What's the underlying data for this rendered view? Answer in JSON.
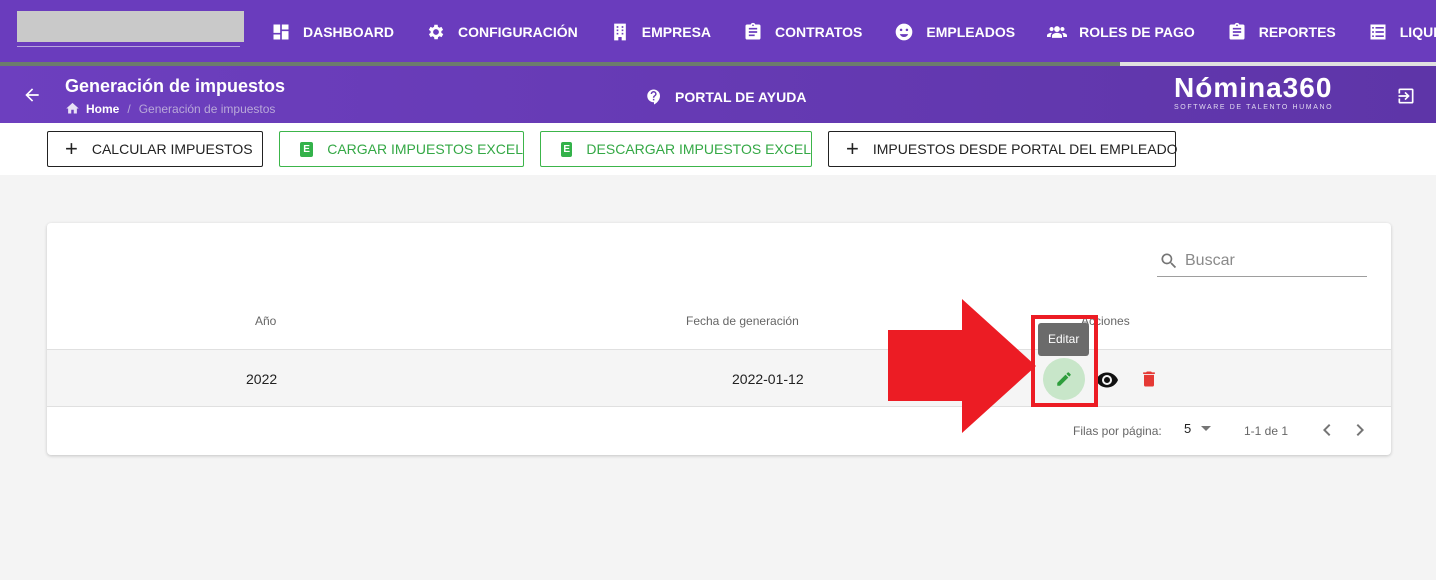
{
  "nav": {
    "items": [
      {
        "label": "DASHBOARD",
        "icon": "dashboard-icon"
      },
      {
        "label": "CONFIGURACIÓN",
        "icon": "gear-icon"
      },
      {
        "label": "EMPRESA",
        "icon": "building-icon"
      },
      {
        "label": "CONTRATOS",
        "icon": "clipboard-icon"
      },
      {
        "label": "EMPLEADOS",
        "icon": "face-icon"
      },
      {
        "label": "ROLES DE PAGO",
        "icon": "group-icon"
      },
      {
        "label": "REPORTES",
        "icon": "clipboard-icon"
      },
      {
        "label": "LIQUIDACIONE",
        "icon": "list-icon"
      }
    ],
    "progress": 0.78
  },
  "header": {
    "title": "Generación de impuestos",
    "breadcrumb": {
      "home": "Home",
      "separator": "/",
      "current": "Generación de impuestos"
    },
    "help_label": "PORTAL DE AYUDA",
    "brand_name": "Nómina360",
    "brand_tagline": "SOFTWARE DE TALENTO HUMANO"
  },
  "actions": {
    "calcular": "CALCULAR IMPUESTOS",
    "cargar": "CARGAR IMPUESTOS EXCEL",
    "descargar": "DESCARGAR IMPUESTOS EXCEL",
    "portal": "IMPUESTOS DESDE PORTAL DEL EMPLEADO",
    "excel_glyph": "E"
  },
  "table": {
    "search_placeholder": "Buscar",
    "columns": {
      "year": "Año",
      "date": "Fecha de generación",
      "actions": "Acciones"
    },
    "rows": [
      {
        "year": "2022",
        "date": "2022-01-12"
      }
    ],
    "tooltip": "Editar",
    "footer": {
      "rows_per_page_label": "Filas por página:",
      "rows_per_page": "5",
      "range": "1-1 de 1"
    }
  },
  "colors": {
    "nav_bg": "#6a3cbd",
    "accent_green": "#33b24a",
    "annotation_red": "#ec1c24",
    "delete_red": "#e53935"
  }
}
